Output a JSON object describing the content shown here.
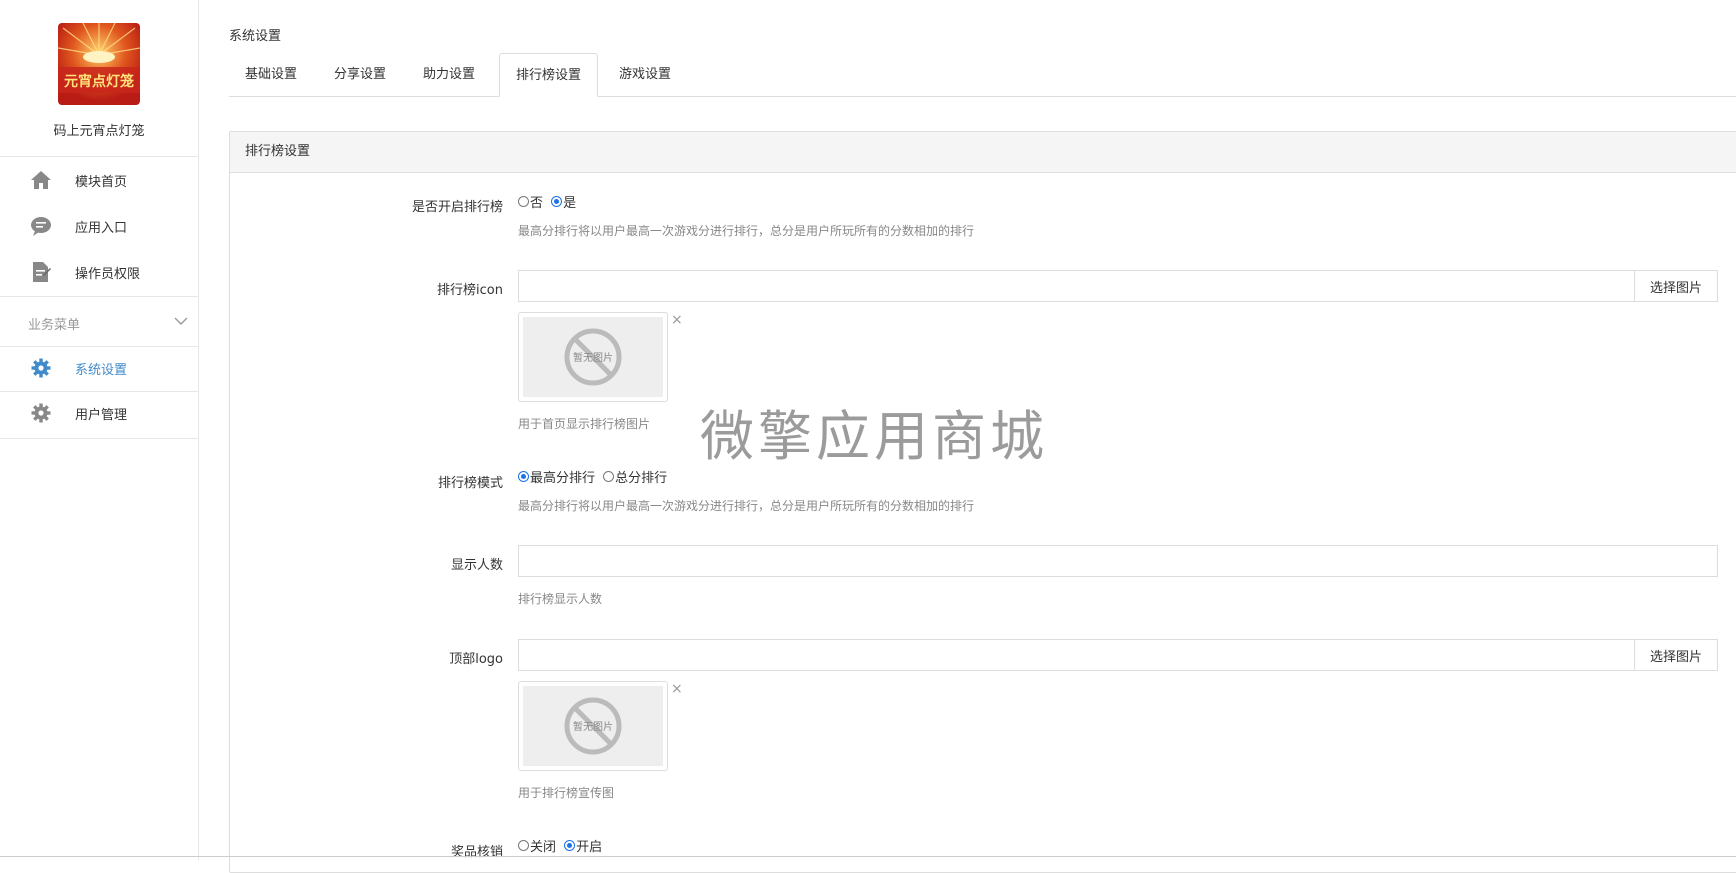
{
  "sidebar": {
    "logo_text": "元宵点灯笼",
    "app_name": "码上元宵点灯笼",
    "top_items": [
      {
        "label": "模块首页",
        "icon": "home-icon"
      },
      {
        "label": "应用入口",
        "icon": "chat-icon"
      },
      {
        "label": "操作员权限",
        "icon": "doc-edit-icon"
      }
    ],
    "group_label": "业务菜单",
    "group_items": [
      {
        "label": "系统设置",
        "icon": "gear-icon",
        "active": true
      },
      {
        "label": "用户管理",
        "icon": "gear-icon",
        "active": false
      }
    ]
  },
  "breadcrumb": "系统设置",
  "tabs": [
    {
      "label": "基础设置",
      "active": false
    },
    {
      "label": "分享设置",
      "active": false
    },
    {
      "label": "助力设置",
      "active": false
    },
    {
      "label": "排行榜设置",
      "active": true
    },
    {
      "label": "游戏设置",
      "active": false
    }
  ],
  "panel": {
    "title": "排行榜设置",
    "fields": {
      "enable": {
        "label": "是否开启排行榜",
        "options": [
          "否",
          "是"
        ],
        "selected": "是",
        "help": "最高分排行将以用户最高一次游戏分进行排行，总分是用户所玩所有的分数相加的排行"
      },
      "icon": {
        "label": "排行榜icon",
        "value": "",
        "button": "选择图片",
        "placeholder_image_text": "暂无图片",
        "remove": "×",
        "help": "用于首页显示排行榜图片"
      },
      "mode": {
        "label": "排行榜模式",
        "options": [
          "最高分排行",
          "总分排行"
        ],
        "selected": "最高分排行",
        "help": "最高分排行将以用户最高一次游戏分进行排行，总分是用户所玩所有的分数相加的排行"
      },
      "count": {
        "label": "显示人数",
        "value": "",
        "help": "排行榜显示人数"
      },
      "top_logo": {
        "label": "顶部logo",
        "value": "",
        "button": "选择图片",
        "placeholder_image_text": "暂无图片",
        "remove": "×",
        "help": "用于排行榜宣传图"
      },
      "prize": {
        "label": "奖品核销",
        "options": [
          "关闭",
          "开启"
        ],
        "selected": "开启"
      }
    }
  },
  "watermark": "微擎应用商城",
  "colors": {
    "accent": "#428bca",
    "radio": "#1a73e8",
    "logo_red": "#c8261b",
    "logo_gold": "#f5c03a"
  }
}
